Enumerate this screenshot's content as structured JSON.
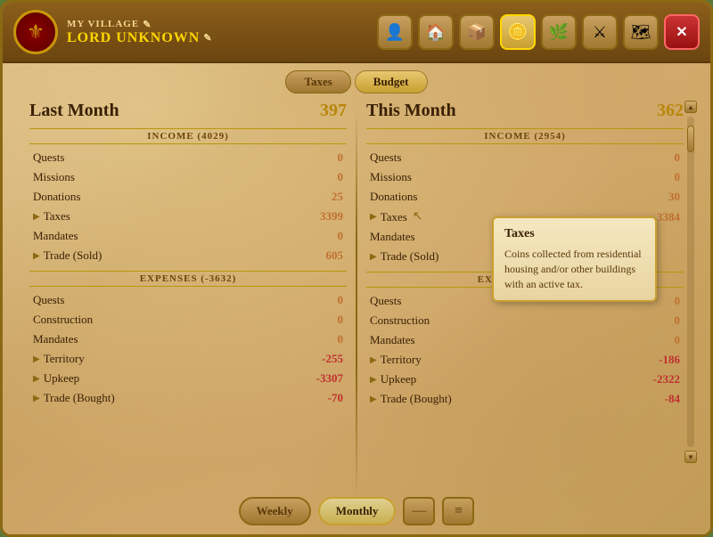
{
  "header": {
    "village_label": "MY VILLAGE",
    "lord_label": "LORD UNKNOWN",
    "edit_icon_village": "✎",
    "edit_icon_lord": "✎",
    "emblem_icon": "⚜"
  },
  "nav_icons": [
    {
      "id": "person",
      "icon": "👤",
      "active": false
    },
    {
      "id": "house",
      "icon": "🏠",
      "active": false
    },
    {
      "id": "chest",
      "icon": "📦",
      "active": false
    },
    {
      "id": "coin",
      "icon": "🪙",
      "active": true
    },
    {
      "id": "wreath",
      "icon": "🌿",
      "active": false
    },
    {
      "id": "sword",
      "icon": "⚔",
      "active": false
    },
    {
      "id": "map",
      "icon": "🗺",
      "active": false
    },
    {
      "id": "close",
      "icon": "✕",
      "active": false
    }
  ],
  "tabs": [
    {
      "id": "taxes",
      "label": "Taxes",
      "active": false
    },
    {
      "id": "budget",
      "label": "Budget",
      "active": true
    }
  ],
  "last_month": {
    "title": "Last Month",
    "total": "397",
    "income_section": "INCOME (4029)",
    "income_rows": [
      {
        "label": "Quests",
        "value": "0",
        "type": "zero",
        "expandable": false
      },
      {
        "label": "Missions",
        "value": "0",
        "type": "zero",
        "expandable": false
      },
      {
        "label": "Donations",
        "value": "25",
        "type": "positive",
        "expandable": false
      },
      {
        "label": "Taxes",
        "value": "3399",
        "type": "positive",
        "expandable": true
      },
      {
        "label": "Mandates",
        "value": "0",
        "type": "zero",
        "expandable": false
      },
      {
        "label": "Trade (Sold)",
        "value": "605",
        "type": "positive",
        "expandable": true
      }
    ],
    "expenses_section": "EXPENSES (-3632)",
    "expense_rows": [
      {
        "label": "Quests",
        "value": "0",
        "type": "zero",
        "expandable": false
      },
      {
        "label": "Construction",
        "value": "0",
        "type": "zero",
        "expandable": false
      },
      {
        "label": "Mandates",
        "value": "0",
        "type": "zero",
        "expandable": false
      },
      {
        "label": "Territory",
        "value": "-255",
        "type": "negative",
        "expandable": true
      },
      {
        "label": "Upkeep",
        "value": "-3307",
        "type": "negative",
        "expandable": true
      },
      {
        "label": "Trade (Bought)",
        "value": "-70",
        "type": "negative",
        "expandable": true
      }
    ]
  },
  "this_month": {
    "title": "This Month",
    "total": "362",
    "income_section": "INCOME (2954)",
    "income_rows": [
      {
        "label": "Quests",
        "value": "0",
        "type": "zero",
        "expandable": false
      },
      {
        "label": "Missions",
        "value": "0",
        "type": "zero",
        "expandable": false
      },
      {
        "label": "Donations",
        "value": "30",
        "type": "positive",
        "expandable": false
      },
      {
        "label": "Taxes",
        "value": "3384",
        "type": "positive",
        "expandable": true,
        "tooltip": true
      },
      {
        "label": "Mandates",
        "value": "",
        "type": "zero",
        "expandable": false
      },
      {
        "label": "Trade (Sold)",
        "value": "",
        "type": "zero",
        "expandable": true
      }
    ],
    "expenses_section": "EXPENSES (-25...)",
    "expense_rows": [
      {
        "label": "Quests",
        "value": "0",
        "type": "zero",
        "expandable": false
      },
      {
        "label": "Construction",
        "value": "0",
        "type": "zero",
        "expandable": false
      },
      {
        "label": "Mandates",
        "value": "0",
        "type": "zero",
        "expandable": false
      },
      {
        "label": "Territory",
        "value": "-186",
        "type": "negative",
        "expandable": true
      },
      {
        "label": "Upkeep",
        "value": "-2322",
        "type": "negative",
        "expandable": true
      },
      {
        "label": "Trade (Bought)",
        "value": "-84",
        "type": "negative",
        "expandable": true
      }
    ]
  },
  "tooltip": {
    "title": "Taxes",
    "text": "Coins collected from residential housing and/or other buildings with an active tax."
  },
  "bottom": {
    "weekly_label": "Weekly",
    "monthly_label": "Monthly",
    "chart_icon": "—",
    "list_icon": "≡"
  }
}
